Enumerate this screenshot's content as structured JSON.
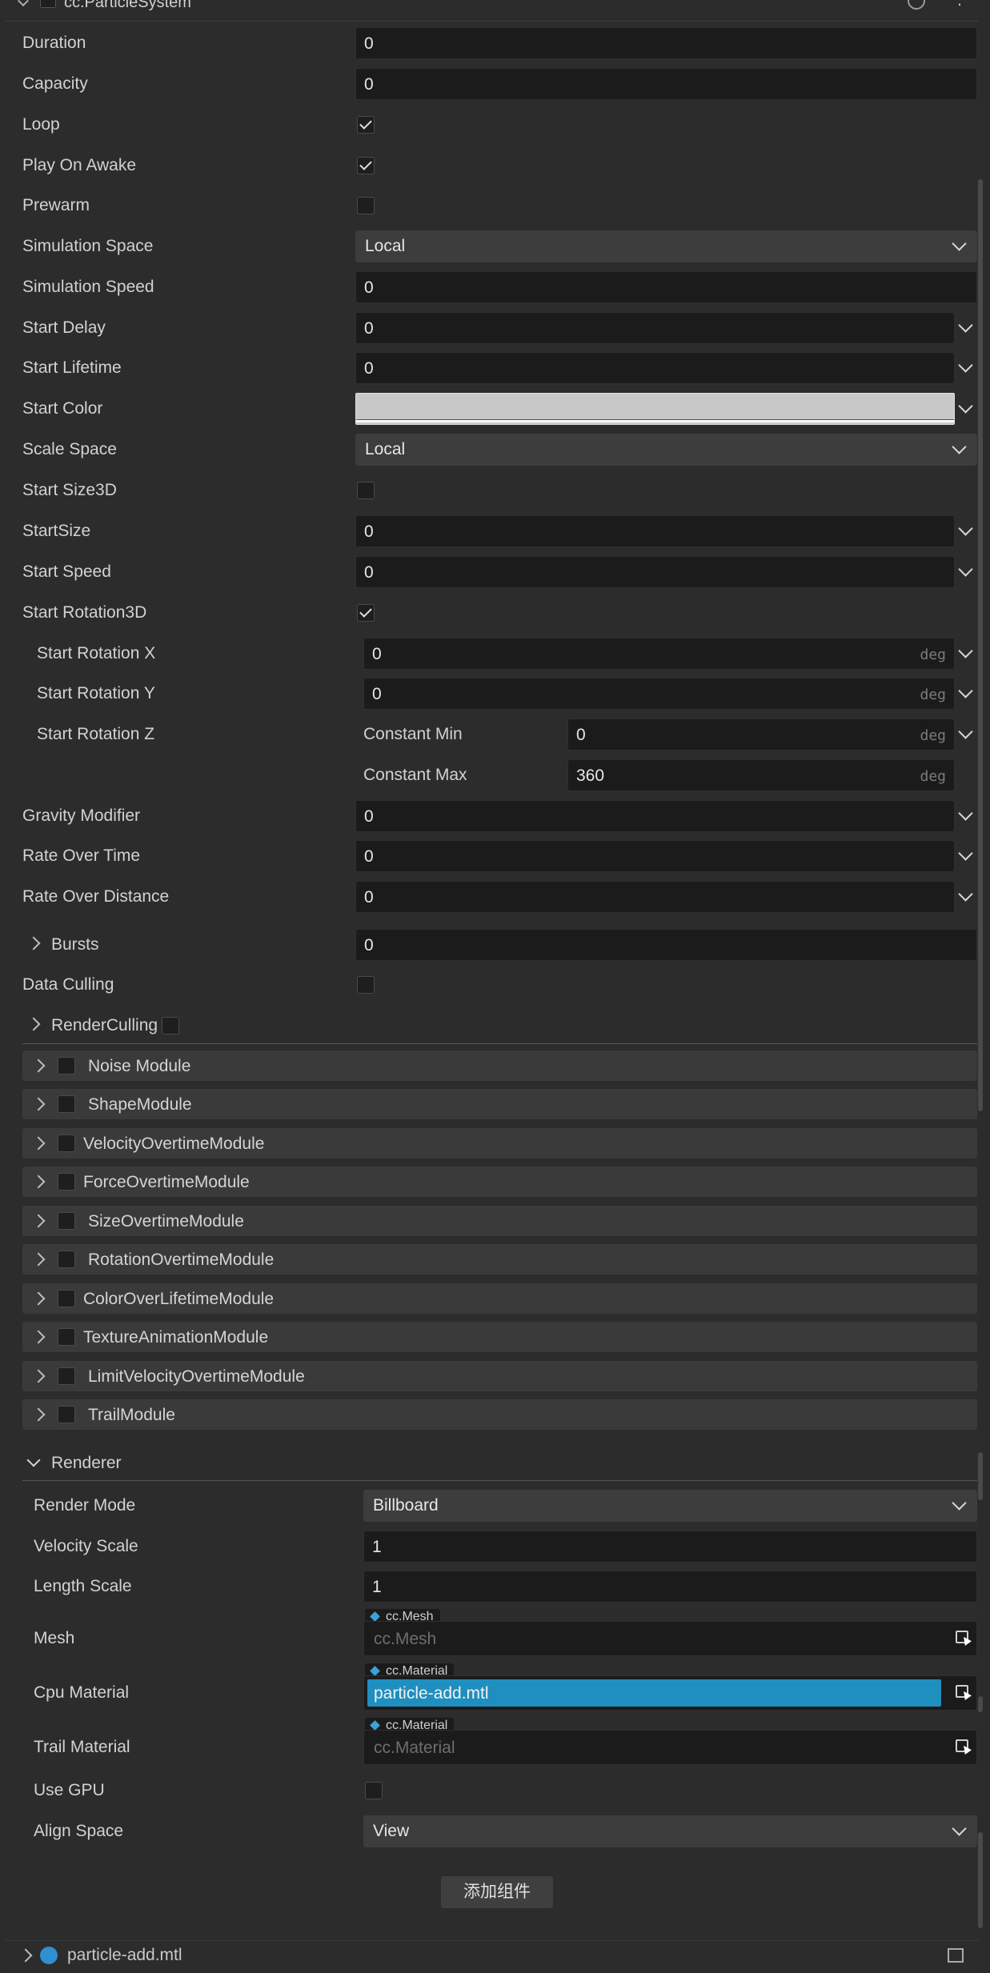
{
  "header": {
    "title": "cc.ParticleSystem"
  },
  "props": [
    {
      "label": "Duration",
      "value": "0"
    },
    {
      "label": "Capacity",
      "value": "0"
    },
    {
      "label": "Loop",
      "checked": true
    },
    {
      "label": "Play On Awake",
      "checked": true
    },
    {
      "label": "Prewarm",
      "checked": false
    },
    {
      "label": "Simulation Space",
      "value": "Local"
    },
    {
      "label": "Simulation Speed",
      "value": "0"
    },
    {
      "label": "Start Delay",
      "value": "0"
    },
    {
      "label": "Start Lifetime",
      "value": "0"
    },
    {
      "label": "Start Color",
      "color": "#c8c8c8"
    },
    {
      "label": "Scale Space",
      "value": "Local"
    },
    {
      "label": "Start Size3D",
      "checked": false
    },
    {
      "label": "StartSize",
      "value": "0"
    },
    {
      "label": "Start Speed",
      "value": "0"
    },
    {
      "label": "Start Rotation3D",
      "checked": true
    },
    {
      "label": "Start Rotation X",
      "value": "0",
      "unit": "deg"
    },
    {
      "label": "Start Rotation Y",
      "value": "0",
      "unit": "deg"
    },
    {
      "label": "Start Rotation Z",
      "min_label": "Constant Min",
      "min_value": "0",
      "max_label": "Constant Max",
      "max_value": "360",
      "unit": "deg"
    },
    {
      "label": "Gravity Modifier",
      "value": "0"
    },
    {
      "label": "Rate Over Time",
      "value": "0"
    },
    {
      "label": "Rate Over Distance",
      "value": "0"
    },
    {
      "label": "Bursts",
      "value": "0"
    },
    {
      "label": "Data Culling",
      "checked": false
    },
    {
      "label": "RenderCulling",
      "checked": false
    }
  ],
  "modules": [
    "Noise Module",
    "ShapeModule",
    "VelocityOvertimeModule",
    "ForceOvertimeModule",
    "SizeOvertimeModule",
    "RotationOvertimeModule",
    "ColorOverLifetimeModule",
    "TextureAnimationModule",
    "LimitVelocityOvertimeModule",
    "TrailModule"
  ],
  "renderer": {
    "title": "Renderer",
    "render_mode": {
      "label": "Render Mode",
      "value": "Billboard"
    },
    "velocity_scale": {
      "label": "Velocity Scale",
      "value": "1"
    },
    "length_scale": {
      "label": "Length Scale",
      "value": "1"
    },
    "mesh": {
      "label": "Mesh",
      "type": "cc.Mesh",
      "placeholder": "cc.Mesh"
    },
    "cpu_material": {
      "label": "Cpu Material",
      "type": "cc.Material",
      "value": "particle-add.mtl"
    },
    "trail_material": {
      "label": "Trail Material",
      "type": "cc.Material",
      "placeholder": "cc.Material"
    },
    "use_gpu": {
      "label": "Use GPU",
      "checked": false
    },
    "align_space": {
      "label": "Align Space",
      "value": "View"
    }
  },
  "add_component_label": "添加组件",
  "footer": {
    "file": "particle-add.mtl"
  }
}
